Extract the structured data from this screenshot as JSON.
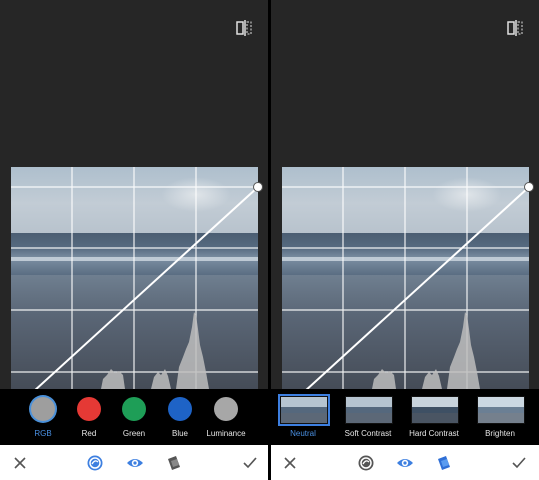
{
  "left_screen": {
    "compare_icon": "compare-split-icon",
    "tool": "curves",
    "channels": [
      {
        "label": "RGB",
        "color": "#9e9e9e",
        "selected": true
      },
      {
        "label": "Red",
        "color": "#e53935",
        "selected": false
      },
      {
        "label": "Green",
        "color": "#1e9e57",
        "selected": false
      },
      {
        "label": "Blue",
        "color": "#1e63c6",
        "selected": false
      },
      {
        "label": "Luminance",
        "color": "#a7a7a7",
        "selected": false
      }
    ],
    "bottom_bar": {
      "cancel_icon": "close-icon",
      "curves_icon": "curves-icon",
      "eye_icon": "eye-icon",
      "styles_icon": "styles-icon",
      "apply_icon": "check-icon",
      "active": "curves"
    }
  },
  "right_screen": {
    "compare_icon": "compare-split-icon",
    "tool": "presets",
    "presets": [
      {
        "label": "Neutral",
        "selected": true
      },
      {
        "label": "Soft Contrast",
        "selected": false
      },
      {
        "label": "Hard Contrast",
        "selected": false
      },
      {
        "label": "Brighten",
        "selected": false
      }
    ],
    "bottom_bar": {
      "cancel_icon": "close-icon",
      "curves_icon": "curves-icon",
      "eye_icon": "eye-icon",
      "styles_icon": "styles-icon",
      "apply_icon": "check-icon",
      "active": "styles"
    }
  },
  "colors": {
    "accent": "#3d7fe0",
    "background": "#262626",
    "grid": "#ffffff"
  }
}
